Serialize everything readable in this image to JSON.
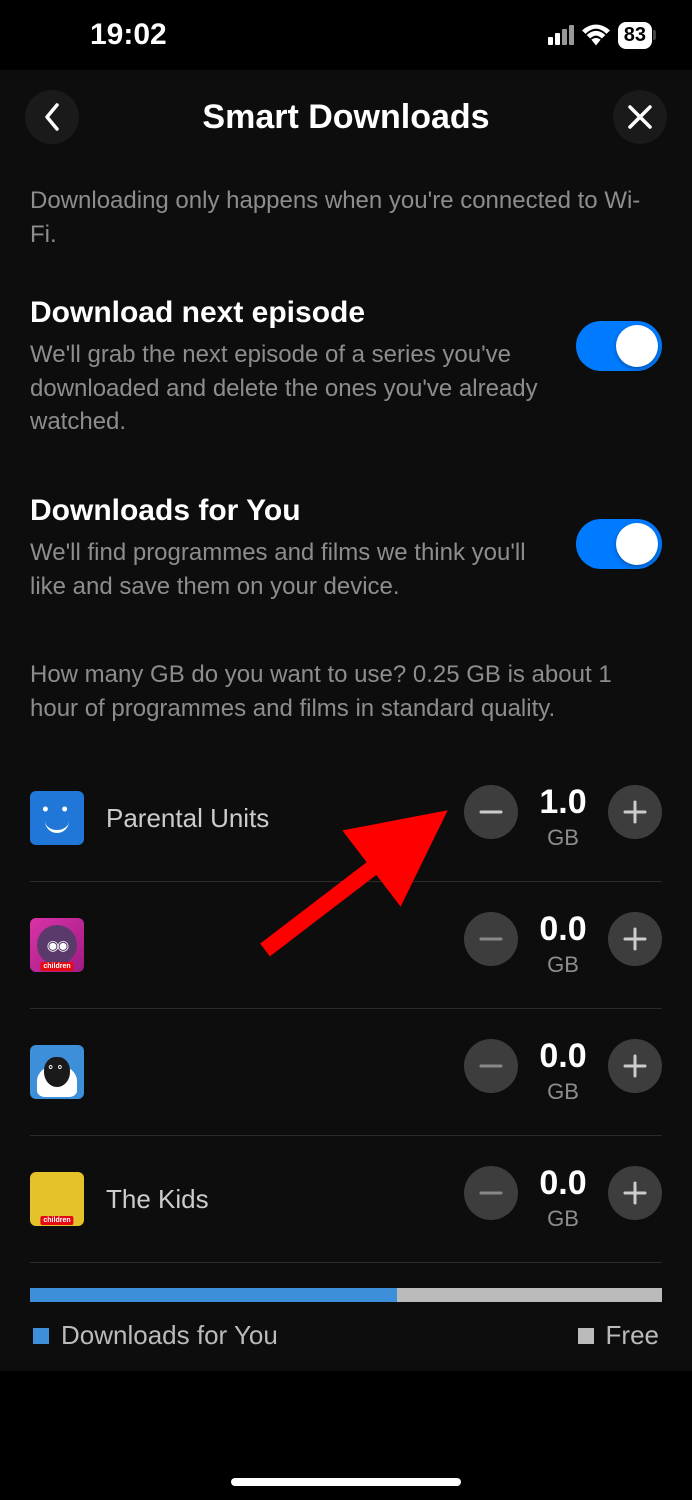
{
  "status": {
    "time": "19:02",
    "battery": "83"
  },
  "header": {
    "title": "Smart Downloads"
  },
  "info_text": "Downloading only happens when you're connected to Wi-Fi.",
  "sections": {
    "next_episode": {
      "title": "Download next episode",
      "desc": "We'll grab the next episode of a series you've downloaded and delete the ones you've already watched.",
      "enabled": true
    },
    "for_you": {
      "title": "Downloads for You",
      "desc": "We'll find programmes and films we think you'll like and save them on your device.",
      "enabled": true
    }
  },
  "storage_prompt": "How many GB do you want to use? 0.25 GB is about 1 hour of programmes and films in standard quality.",
  "profiles": [
    {
      "name": "Parental Units",
      "value": "1.0",
      "unit": "GB",
      "avatar_class": "avatar-blue"
    },
    {
      "name": "",
      "value": "0.0",
      "unit": "GB",
      "avatar_class": "avatar-pink"
    },
    {
      "name": "",
      "value": "0.0",
      "unit": "GB",
      "avatar_class": "avatar-sheep"
    },
    {
      "name": "The Kids",
      "value": "0.0",
      "unit": "GB",
      "avatar_class": "avatar-yellow"
    }
  ],
  "storage_bar": {
    "used_percent": 58
  },
  "legend": {
    "downloads": "Downloads for You",
    "free": "Free"
  }
}
